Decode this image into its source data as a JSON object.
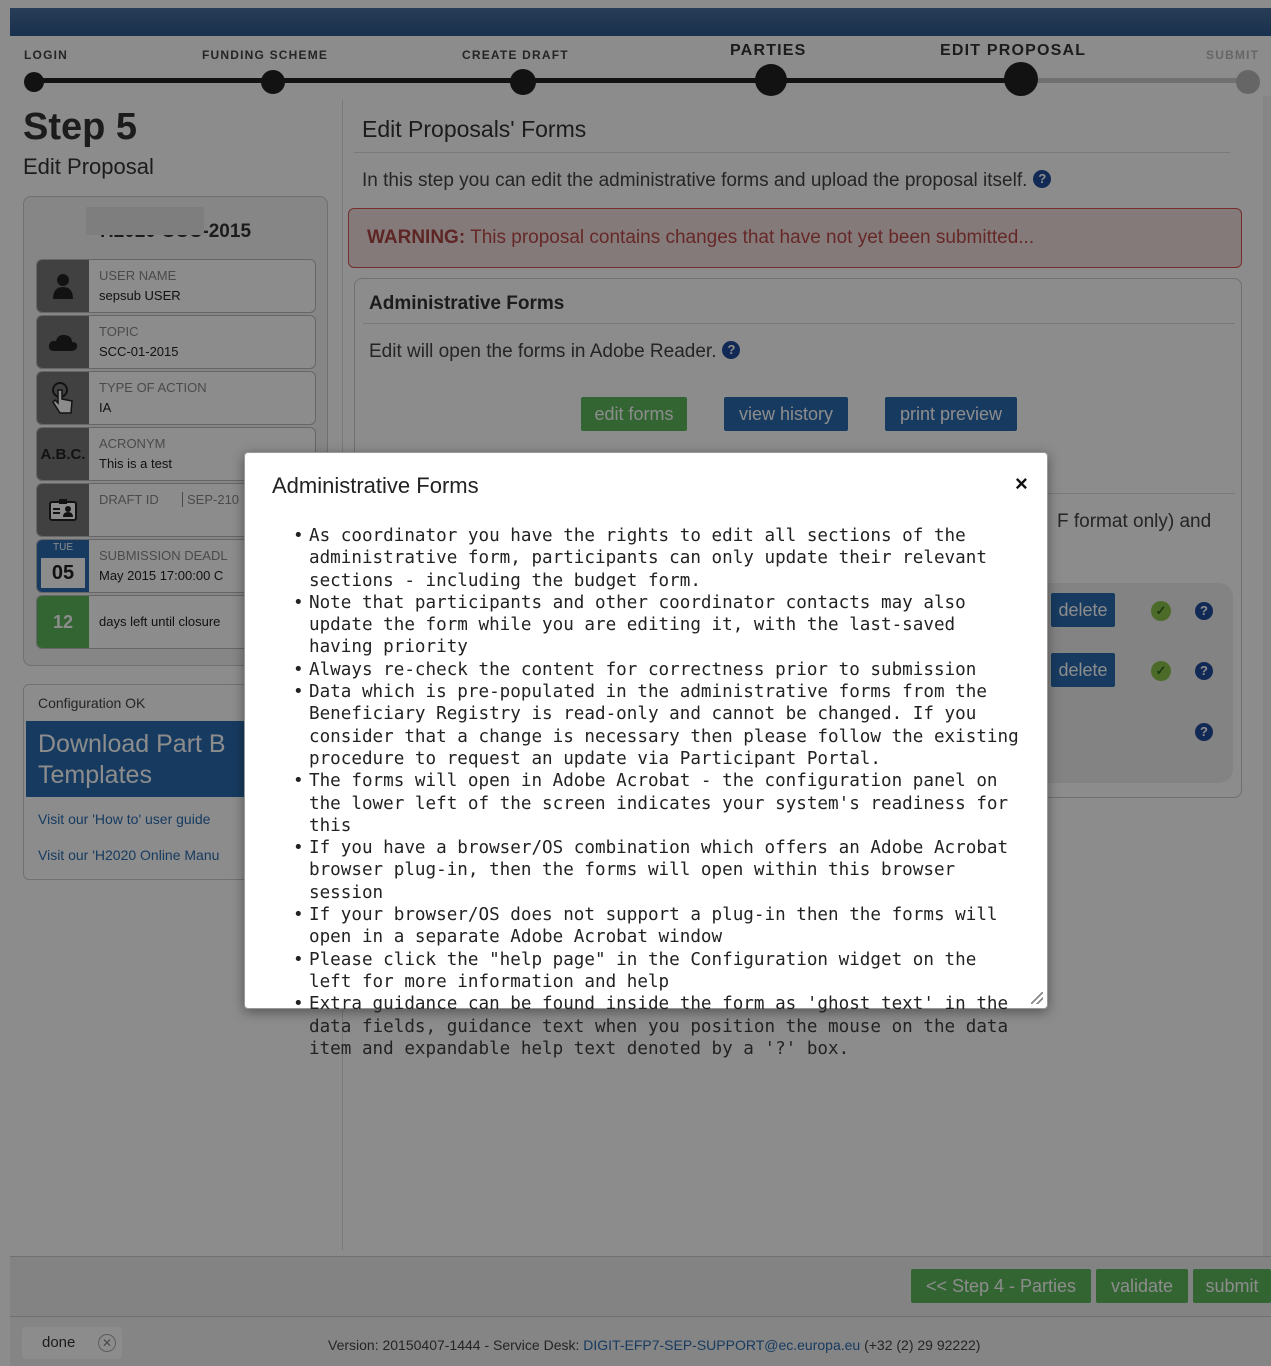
{
  "wizard": {
    "steps": [
      {
        "label": "LOGIN"
      },
      {
        "label": "FUNDING SCHEME"
      },
      {
        "label": "CREATE DRAFT"
      },
      {
        "label": "PARTIES"
      },
      {
        "label": "EDIT PROPOSAL"
      },
      {
        "label": "SUBMIT"
      }
    ]
  },
  "sidebar": {
    "step_title": "Step 5",
    "step_subtitle": "Edit Proposal",
    "card_title": "H2020-SCC-2015",
    "rows": [
      {
        "label": "USER NAME",
        "value": "sepsub USER",
        "icon": "user-icon"
      },
      {
        "label": "TOPIC",
        "value": "SCC-01-2015",
        "icon": "cloud-icon"
      },
      {
        "label": "TYPE OF ACTION",
        "value": "IA",
        "icon": "hand-pointer-icon"
      },
      {
        "label": "ACRONYM",
        "value": "This is a test",
        "icon_text": "A.B.C."
      },
      {
        "label": "DRAFT ID",
        "value_inline": "SEP-210",
        "icon": "id-card-icon"
      },
      {
        "label": "SUBMISSION DEADL",
        "day": "TUE",
        "date": "05",
        "value": "May 2015 17:00:00 C"
      },
      {
        "count": "12",
        "value": "days left until closure"
      }
    ],
    "config": {
      "status": "Configuration OK",
      "download_label": "Download Part B Templates",
      "link_1": "Visit our 'How to' user guide",
      "link_2": "Visit our 'H2020 Online Manu"
    }
  },
  "main": {
    "title": "Edit Proposals' Forms",
    "intro": "In this step you can edit the administrative forms and upload the proposal itself.",
    "warning_label": "WARNING:",
    "warning_text": "This proposal contains changes that have not yet been submitted...",
    "admin_title": "Administrative Forms",
    "admin_note": "Edit will open the forms in Adobe Reader.",
    "buttons": {
      "edit_forms": "edit forms",
      "view_history": "view history",
      "print_preview": "print preview"
    },
    "partial_text": "F format only) and",
    "delete_label": "delete"
  },
  "footer": {
    "prev_label": "<< Step 4 - Parties",
    "validate_label": "validate",
    "submit_label": "submit"
  },
  "status_bar": {
    "done": "done",
    "version_text": "Version: 20150407-1444 - Service Desk:",
    "email": "DIGIT-EFP7-SEP-SUPPORT@ec.europa.eu",
    "phone": "(+32 (2) 29 92222)"
  },
  "modal": {
    "title": "Administrative Forms",
    "close_glyph": "×",
    "items": [
      "As coordinator you have the rights to edit all sections of the administrative form, participants can only update their relevant sections - including the budget form.",
      "Note that participants and other coordinator contacts may also update the form while you are editing it, with the last-saved having priority",
      "Always re-check the content for correctness prior to submission",
      "Data which is pre-populated in the administrative forms from the Beneficiary Registry is read-only and cannot be changed. If you consider that a change is necessary then please follow the existing procedure to request an update via Participant Portal.",
      "The forms will open in Adobe Acrobat - the configuration panel on the lower left of the screen indicates your system's readiness for this",
      "If you have a browser/OS combination which offers an Adobe Acrobat browser plug-in, then the forms will open within this browser session",
      "If your browser/OS does not support a plug-in then the forms will open in a separate Adobe Acrobat window",
      "Please click the \"help page\" in the Configuration widget on the left for more information and help",
      "Extra guidance can be found inside the form as 'ghost text' in the data fields, guidance text when you position the mouse on the data item and expandable help text denoted by a '?' box."
    ]
  }
}
